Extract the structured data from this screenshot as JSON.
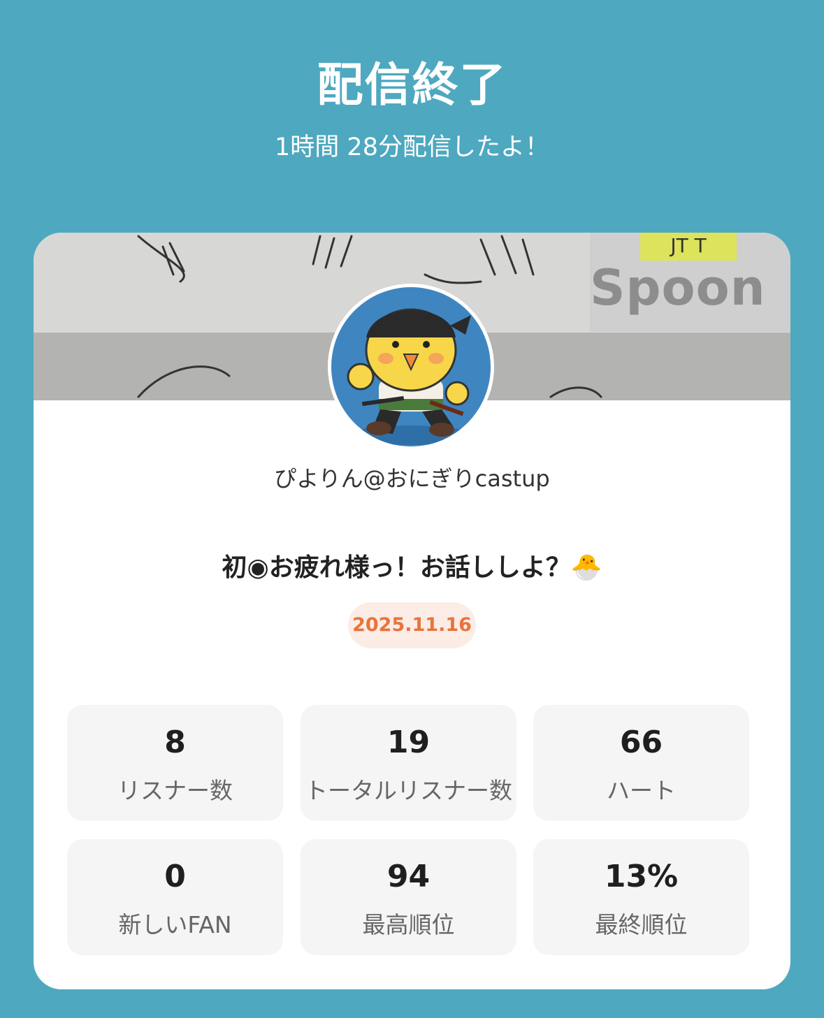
{
  "header": {
    "title": "配信終了",
    "subtitle": "1時間 28分配信したよ！"
  },
  "cover": {
    "logo_text": "Spoon",
    "logo_tag": "JT  T"
  },
  "profile": {
    "username": "ぴよりん@おにぎりcastup",
    "avatar_icon": "chick-pirate-avatar"
  },
  "live": {
    "title": "初◉お疲れ様っ！お話ししよ？🐣",
    "date": "2025.11.16"
  },
  "stats": [
    {
      "value": "8",
      "label": "リスナー数"
    },
    {
      "value": "19",
      "label": "トータルリスナー数"
    },
    {
      "value": "66",
      "label": "ハート"
    },
    {
      "value": "0",
      "label": "新しいFAN"
    },
    {
      "value": "94",
      "label": "最高順位"
    },
    {
      "value": "13%",
      "label": "最終順位"
    }
  ],
  "colors": {
    "background": "#4ea8bf",
    "card": "#ffffff",
    "date_text": "#e8743c",
    "date_bg": "#fbece6"
  }
}
